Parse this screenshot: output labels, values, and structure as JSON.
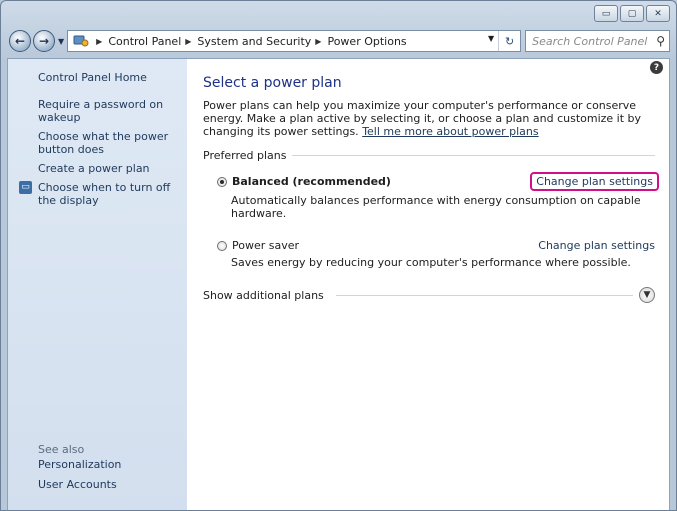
{
  "window": {
    "caption": {
      "minimize": "▭",
      "maximize": "▢",
      "close": "✕"
    }
  },
  "address": {
    "crumbs": [
      "Control Panel",
      "System and Security",
      "Power Options"
    ],
    "refresh_glyph": "↻"
  },
  "search": {
    "placeholder": "Search Control Panel"
  },
  "sidebar": {
    "home": "Control Panel Home",
    "links": [
      "Require a password on wakeup",
      "Choose what the power button does",
      "Create a power plan",
      "Choose when to turn off the display"
    ],
    "see_also": "See also",
    "see_also_links": [
      "Personalization",
      "User Accounts"
    ]
  },
  "main": {
    "title": "Select a power plan",
    "description": "Power plans can help you maximize your computer's performance or conserve energy. Make a plan active by selecting it, or choose a plan and customize it by changing its power settings. ",
    "learn_more": "Tell me more about power plans",
    "preferred_label": "Preferred plans",
    "plans": [
      {
        "name": "Balanced (recommended)",
        "description": "Automatically balances performance with energy consumption on capable hardware.",
        "link": "Change plan settings",
        "selected": true
      },
      {
        "name": "Power saver",
        "description": "Saves energy by reducing your computer's performance where possible.",
        "link": "Change plan settings",
        "selected": false
      }
    ],
    "additional_label": "Show additional plans"
  },
  "icons": {
    "back": "back-arrow-icon",
    "forward": "forward-arrow-icon",
    "help": "help-icon",
    "search": "search-icon",
    "expand": "chevron-down-icon"
  },
  "colors": {
    "title": "#1e3287",
    "link": "#1e395b",
    "highlight": "#d10f8a",
    "sidebar": "#dfe9f5"
  }
}
